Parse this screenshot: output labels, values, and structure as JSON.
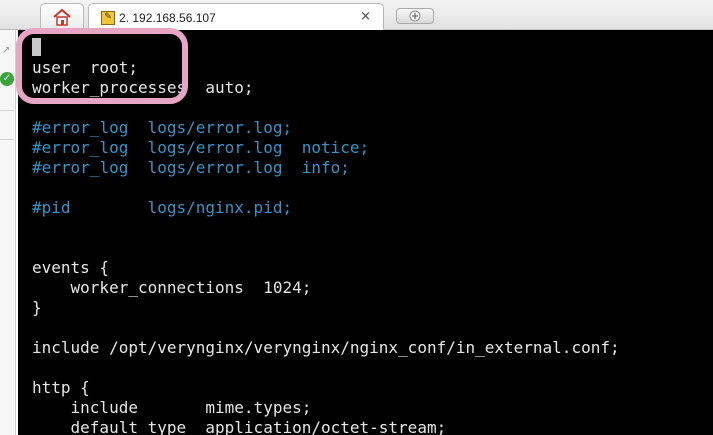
{
  "tabs": {
    "active_title": "2. 192.168.56.107",
    "close_glyph": "×"
  },
  "terminal": {
    "lines": [
      {
        "text": "user  root;",
        "type": "code"
      },
      {
        "text": "worker_processes  auto;",
        "type": "code"
      },
      {
        "text": "#error_log  logs/error.log;",
        "type": "comment"
      },
      {
        "text": "#error_log  logs/error.log  notice;",
        "type": "comment"
      },
      {
        "text": "#error_log  logs/error.log  info;",
        "type": "comment"
      },
      {
        "text": "#pid        logs/nginx.pid;",
        "type": "comment"
      },
      {
        "text": "events {",
        "type": "code"
      },
      {
        "text": "    worker_connections  1024;",
        "type": "code"
      },
      {
        "text": "}",
        "type": "code"
      },
      {
        "text": "include /opt/verynginx/verynginx/nginx_conf/in_external.conf;",
        "type": "code"
      },
      {
        "text": "http {",
        "type": "code"
      },
      {
        "text": "    include       mime.types;",
        "type": "code"
      },
      {
        "text": "    default_type  application/octet-stream;",
        "type": "code"
      }
    ]
  },
  "colors": {
    "terminal_bg": "#000000",
    "code_text": "#e6e6e6",
    "comment_text": "#2f97c8",
    "annotation": "#e6a6c4"
  }
}
